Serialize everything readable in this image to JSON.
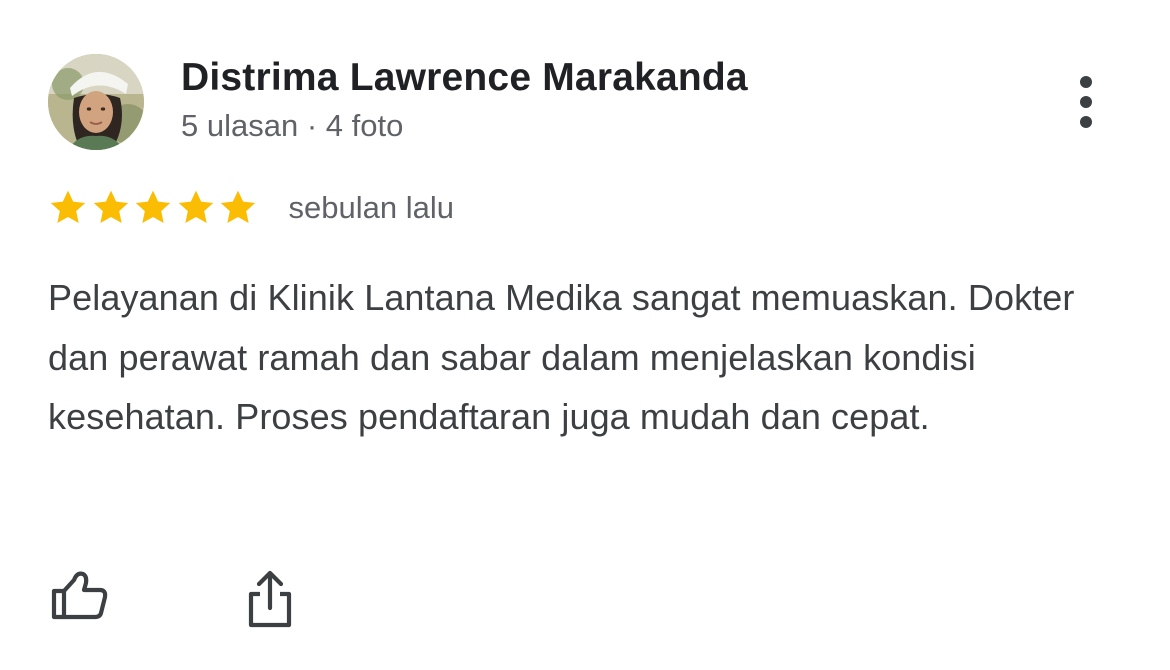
{
  "review": {
    "reviewer_name": "Distrima Lawrence Marakanda",
    "reviewer_meta": "5 ulasan · 4 foto",
    "rating": 5,
    "rating_max": 5,
    "time": "sebulan lalu",
    "text": "Pelayanan di Klinik Lantana Medika sangat memuaskan. Dokter dan perawat ramah dan sabar dalam menjelaskan kondisi kesehatan. Proses pendaftaran juga mudah dan cepat."
  },
  "icons": {
    "avatar": "avatar-photo",
    "more": "more-vert-icon",
    "star": "star-icon",
    "like": "thumbs-up-icon",
    "share": "share-icon"
  },
  "colors": {
    "star": "#fbbc04",
    "name": "#202124",
    "meta": "#5f6368",
    "body": "#3c4043",
    "icon": "#3c4043"
  }
}
